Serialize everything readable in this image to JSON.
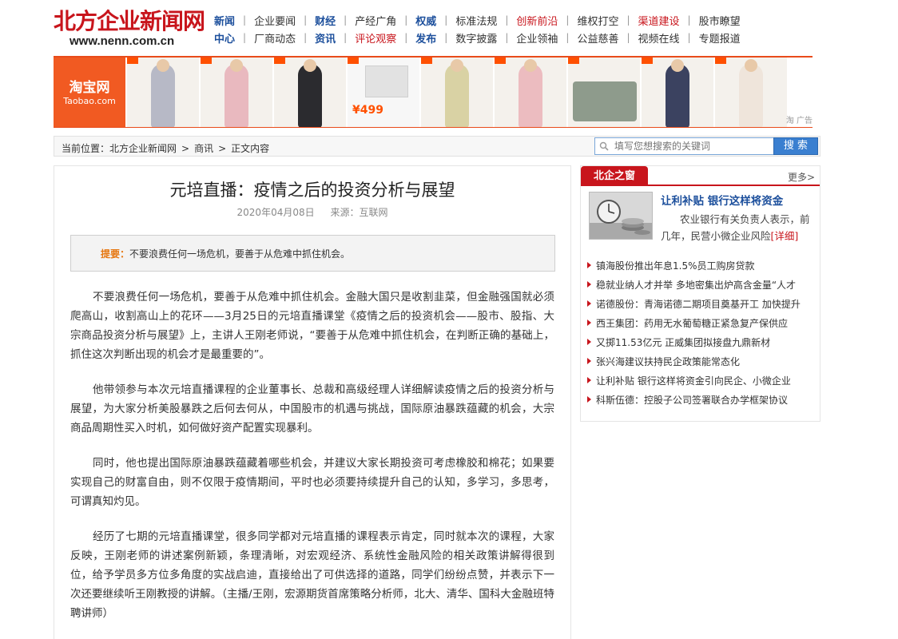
{
  "header": {
    "logo_title": "北方企业新闻网",
    "logo_url": "www.nenn.com.cn",
    "nav_rows": [
      [
        {
          "label": "新闻",
          "style": "blue"
        },
        {
          "label": "企业要闻",
          "style": ""
        },
        {
          "label": "财经",
          "style": "blue"
        },
        {
          "label": "产经广角",
          "style": ""
        },
        {
          "label": "权威",
          "style": "blue"
        },
        {
          "label": "标准法规",
          "style": ""
        },
        {
          "label": "创新前沿",
          "style": "red"
        },
        {
          "label": "维权打空",
          "style": ""
        },
        {
          "label": "渠道建设",
          "style": "red"
        },
        {
          "label": "股市瞭望",
          "style": ""
        }
      ],
      [
        {
          "label": "中心",
          "style": "blue"
        },
        {
          "label": "厂商动态",
          "style": ""
        },
        {
          "label": "资讯",
          "style": "blue"
        },
        {
          "label": "评论观察",
          "style": "red"
        },
        {
          "label": "发布",
          "style": "blue"
        },
        {
          "label": "数字披露",
          "style": ""
        },
        {
          "label": "企业领袖",
          "style": ""
        },
        {
          "label": "公益慈善",
          "style": ""
        },
        {
          "label": "视频在线",
          "style": ""
        },
        {
          "label": "专题报道",
          "style": ""
        }
      ]
    ]
  },
  "banner": {
    "brand_cn": "淘宝网",
    "brand_en": "Taobao.com",
    "price": "¥499",
    "ad_mark": "淘 广告",
    "colors": [
      "#b7b9c6",
      "#e9b9bf",
      "#2b2b2f",
      "#e6e6e6",
      "#d9d2a4",
      "#ecbcc0",
      "#8e9b8c",
      "#3b4260",
      "#efe5db"
    ]
  },
  "crumbbar": {
    "items": [
      "当前位置：北方企业新闻网",
      ">",
      "商讯",
      ">",
      "正文内容"
    ],
    "search_placeholder": "填写您想搜索的关键词",
    "search_button": "搜 索"
  },
  "article": {
    "title": "元培直播：疫情之后的投资分析与展望",
    "date": "2020年04月08日",
    "source": "来源：互联网",
    "summary_label": "提要：",
    "summary_text": "不要浪费任何一场危机，要善于从危难中抓住机会。",
    "paragraphs": [
      "不要浪费任何一场危机，要善于从危难中抓住机会。金融大国只是收割韭菜，但金融强国就必须爬高山，收割高山上的花环——3月25日的元培直播课堂《疫情之后的投资机会——股市、股指、大宗商品投资分析与展望》上，主讲人王刚老师说，“要善于从危难中抓住机会，在判断正确的基础上，抓住这次判断出现的机会才是最重要的”。",
      "他带领参与本次元培直播课程的企业董事长、总裁和高级经理人详细解读疫情之后的投资分析与展望，为大家分析美股暴跌之后何去何从，中国股市的机遇与挑战，国际原油暴跌蕴藏的机会，大宗商品周期性买入时机，如何做好资产配置实现暴利。",
      "同时，他也提出国际原油暴跌蕴藏着哪些机会，并建议大家长期投资可考虑橡胶和棉花；如果要实现自己的财富自由，则不仅限于疫情期间，平时也必须要持续提升自己的认知，多学习，多思考，可谓真知灼见。",
      "经历了七期的元培直播课堂，很多同学都对元培直播的课程表示肯定，同时就本次的课程，大家反映，王刚老师的讲述案例新颖，条理清晰，对宏观经济、系统性金融风险的相关政策讲解得很到位，给予学员多方位多角度的实战启迪，直接给出了可供选择的道路，同学们纷纷点赞，并表示下一次还要继续听王刚教授的讲解。（主播/王刚，宏源期货首席策略分析师，北大、清华、国科大金融班特聘讲师）"
    ]
  },
  "sidebar": {
    "tab": "北企之窗",
    "more": "更多>",
    "feature_title": "让利补贴 银行这样将资金",
    "feature_desc": "农业银行有关负责人表示，前几年，民营小微企业风险",
    "feature_detail": "[详细]",
    "items": [
      "镇海股份推出年息1.5%员工购房贷款",
      "稳就业纳人才并举 多地密集出炉高含金量“人才",
      "诺德股份：青海诺德二期项目奠基开工 加快提升",
      "西王集团：药用无水葡萄糖正紧急复产保供应",
      "又掷11.53亿元 正威集团拟接盘九鼎新材",
      "张兴海建议扶持民企政策能常态化",
      "让利补贴 银行这样将资金引向民企、小微企业",
      "科斯伍德：控股子公司签署联合办学框架协议"
    ]
  }
}
